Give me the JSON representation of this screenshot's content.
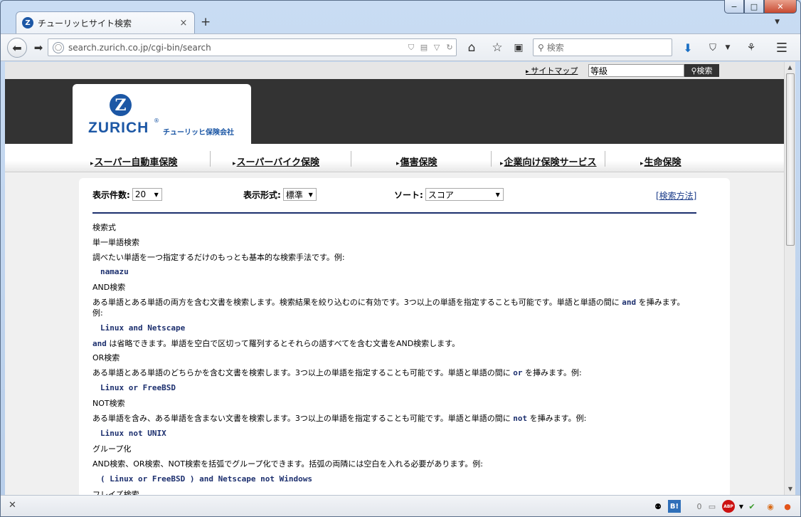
{
  "window": {
    "minimize": "−",
    "maximize": "□",
    "close": "✕"
  },
  "tab": {
    "title": "チューリッヒサイト検索",
    "favicon_letter": "Z",
    "close": "×",
    "new_tab": "+"
  },
  "navbar": {
    "url": "search.zurich.co.jp/cgi-bin/search",
    "search_placeholder": "検索"
  },
  "site": {
    "sitemap": "サイトマップ",
    "search_value": "等級",
    "search_button": "検索",
    "logo_letter": "Z",
    "logo_text": "ZURICH",
    "logo_reg": "®",
    "logo_sub": "チューリッヒ保険会社",
    "categories": [
      "スーパー自動車保険",
      "スーパーバイク保険",
      "傷害保険",
      "企業向け保険サービス",
      "生命保険"
    ]
  },
  "controls": {
    "count_label": "表示件数:",
    "count_value": "20",
    "format_label": "表示形式:",
    "format_value": "標準",
    "sort_label": "ソート:",
    "sort_value": "スコア",
    "howto": "[検索方法]"
  },
  "content": {
    "heading": "検索式",
    "single_title": "単一単語検索",
    "single_desc": "調べたい単語を一つ指定するだけのもっとも基本的な検索手法です。例:",
    "single_example": "namazu",
    "and_title": "AND検索",
    "and_desc_a": "ある単語とある単語の両方を含む文書を検索します。検索結果を絞り込むのに有効です。3つ以上の単語を指定することも可能です。単語と単語の間に",
    "and_kw": "and",
    "and_desc_b": "を挿みます。例:",
    "and_example": "Linux and Netscape",
    "and_note_kw": "and",
    "and_note": "は省略できます。単語を空白で区切って羅列するとそれらの語すべてを含む文書をAND検索します。",
    "or_title": "OR検索",
    "or_desc_a": "ある単語とある単語のどちらかを含む文書を検索します。3つ以上の単語を指定することも可能です。単語と単語の間に",
    "or_kw": "or",
    "or_desc_b": "を挿みます。例:",
    "or_example": "Linux or FreeBSD",
    "not_title": "NOT検索",
    "not_desc_a": "ある単語を含み、ある単語を含まない文書を検索します。3つ以上の単語を指定することも可能です。単語と単語の間に",
    "not_kw": "not",
    "not_desc_b": "を挿みます。例:",
    "not_example": "Linux not UNIX",
    "group_title": "グループ化",
    "group_desc": "AND検索、OR検索、NOT検索を括弧でグループ化できます。括弧の両隣には空白を入れる必要があります。例:",
    "group_example": "( Linux or FreeBSD ) and Netscape not Windows",
    "phrase_title": "フレイズ検索"
  },
  "statusbar": {
    "count": "0",
    "hatena": "B!",
    "abp": "ABP"
  }
}
